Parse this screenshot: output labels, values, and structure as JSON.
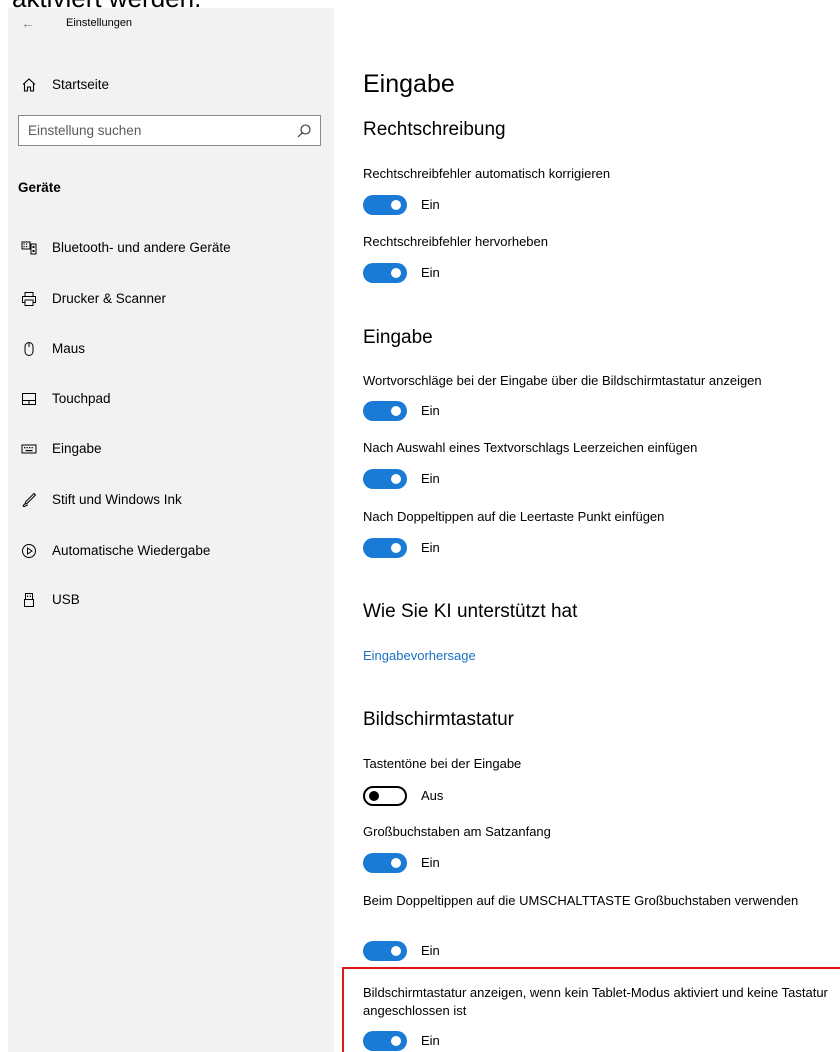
{
  "top_partial_text": "aktiviert werden.",
  "window": {
    "back": "←",
    "title": "Einstellungen"
  },
  "sidebar": {
    "home_label": "Startseite",
    "search_placeholder": "Einstellung suchen",
    "section_label": "Geräte",
    "items": [
      {
        "label": "Bluetooth- und andere Geräte",
        "icon": "bluetooth-devices-icon"
      },
      {
        "label": "Drucker & Scanner",
        "icon": "printer-icon"
      },
      {
        "label": "Maus",
        "icon": "mouse-icon"
      },
      {
        "label": "Touchpad",
        "icon": "touchpad-icon"
      },
      {
        "label": "Eingabe",
        "icon": "keyboard-icon"
      },
      {
        "label": "Stift und Windows Ink",
        "icon": "pen-icon"
      },
      {
        "label": "Automatische Wiedergabe",
        "icon": "autoplay-icon"
      },
      {
        "label": "USB",
        "icon": "usb-icon"
      }
    ]
  },
  "main": {
    "title": "Eingabe",
    "sections": {
      "spell": "Rechtschreibung",
      "typing": "Eingabe",
      "ai": "Wie Sie KI unterstützt hat",
      "touch": "Bildschirmtastatur"
    },
    "settings": {
      "autocorrect": {
        "label": "Rechtschreibfehler automatisch korrigieren",
        "state": "Ein"
      },
      "highlight": {
        "label": "Rechtschreibfehler hervorheben",
        "state": "Ein"
      },
      "suggestions": {
        "label": "Wortvorschläge bei der Eingabe über die Bildschirmtastatur anzeigen",
        "state": "Ein"
      },
      "space_after": {
        "label": "Nach Auswahl eines Textvorschlags Leerzeichen einfügen",
        "state": "Ein"
      },
      "double_tap_period": {
        "label": "Nach Doppeltippen auf die Leertaste Punkt einfügen",
        "state": "Ein"
      },
      "key_sounds": {
        "label": "Tastentöne bei der Eingabe",
        "state": "Aus"
      },
      "capitalize": {
        "label": "Großbuchstaben am Satzanfang",
        "state": "Ein"
      },
      "caps_lock": {
        "label": "Beim Doppeltippen auf die UMSCHALTTASTE Großbuchstaben verwenden",
        "state": "Ein"
      },
      "show_keyboard": {
        "label": "Bildschirmtastatur anzeigen, wenn kein Tablet-Modus aktiviert und keine Tastatur angeschlossen ist",
        "state": "Ein"
      }
    },
    "ai_link": "Eingabevorhersage"
  },
  "colors": {
    "accent": "#1a7bd6",
    "highlight_border": "#e0161b",
    "sidebar_bg": "#f2f2f2"
  }
}
